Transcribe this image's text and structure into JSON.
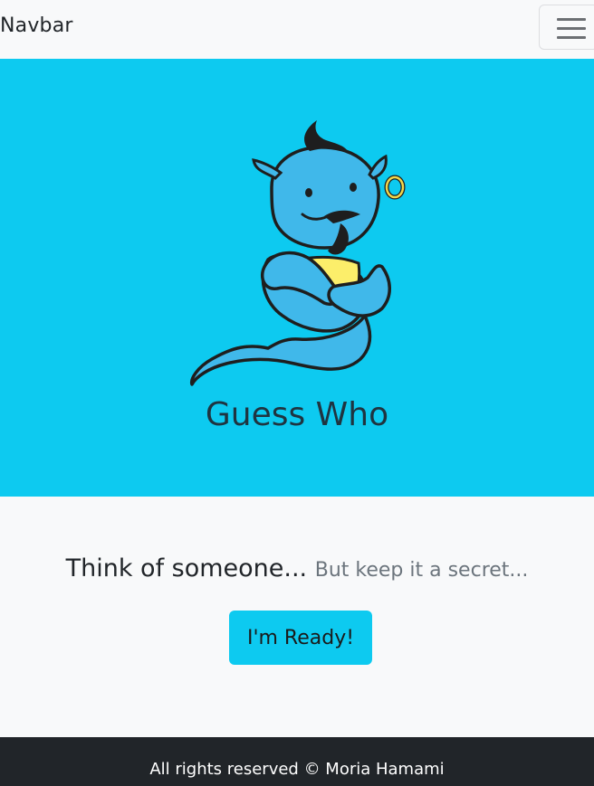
{
  "navbar": {
    "brand": "Navbar",
    "toggler_icon": "hamburger-menu-icon"
  },
  "hero": {
    "logo_icon": "genie-logo-icon",
    "title": "Guess Who",
    "background_color": "#0dcaf0"
  },
  "main": {
    "heading": "Think of someone...",
    "subheading": "But keep it a secret...",
    "ready_button": "I'm Ready!",
    "button_color": "#0dcaf0"
  },
  "footer": {
    "text": "All rights reserved © Moria Hamami",
    "background_color": "#212529"
  }
}
